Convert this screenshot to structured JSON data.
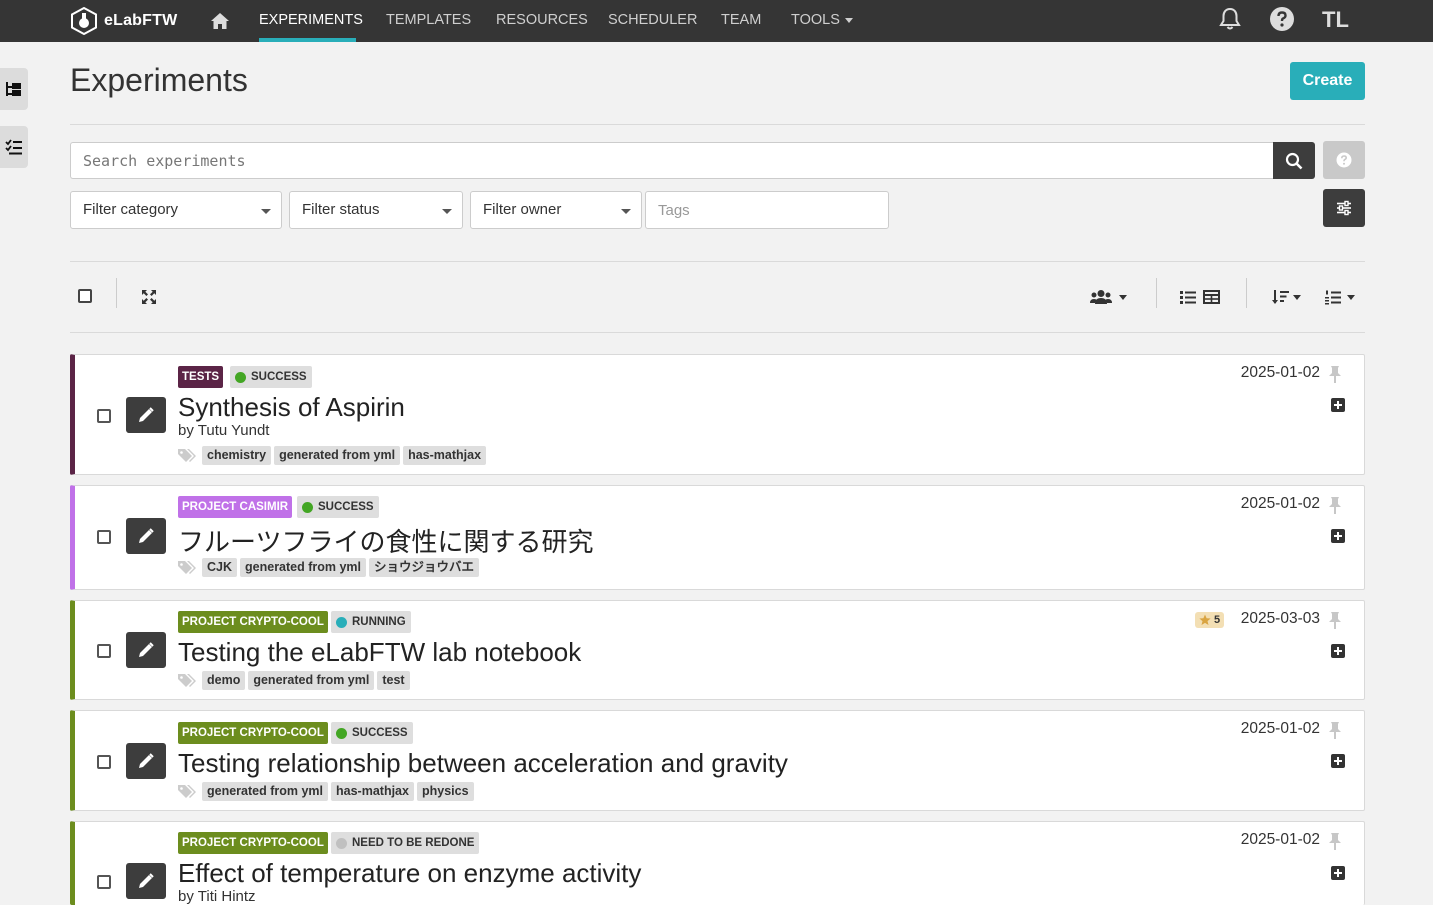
{
  "brand": {
    "name": "eLabFTW"
  },
  "nav": {
    "items": [
      {
        "label": "EXPERIMENTS",
        "active": true
      },
      {
        "label": "TEMPLATES"
      },
      {
        "label": "RESOURCES"
      },
      {
        "label": "SCHEDULER"
      },
      {
        "label": "TEAM"
      },
      {
        "label": "TOOLS",
        "dropdown": true
      }
    ],
    "icons": [
      "home-icon",
      "bell-icon",
      "help-icon"
    ],
    "user_initials": "TL"
  },
  "page": {
    "title": "Experiments",
    "create_label": "Create"
  },
  "search": {
    "placeholder": "Search experiments",
    "filters": {
      "category": "Filter category",
      "status": "Filter status",
      "owner": "Filter owner",
      "tags_placeholder": "Tags"
    }
  },
  "colors": {
    "accent": "#29aeb9",
    "topbar": "#353535",
    "dark_button": "#3d3d3d"
  },
  "entities": [
    {
      "category": "TESTS",
      "category_color": "#5b2446",
      "status": "SUCCESS",
      "status_color": "#43a624",
      "title": "Synthesis of Aspirin",
      "owner_prefix": "by",
      "owner": "Tutu Yundt",
      "tags": [
        "chemistry",
        "generated from yml",
        "has-mathjax"
      ],
      "date": "2025-01-02"
    },
    {
      "category": "PROJECT CASIMIR",
      "category_color": "#c071e8",
      "status": "SUCCESS",
      "status_color": "#43a624",
      "title": "フルーツフライの食性に関する研究",
      "owner_prefix": "",
      "owner": "",
      "tags": [
        "CJK",
        "generated from yml",
        "ショウジョウバエ"
      ],
      "date": "2025-01-02"
    },
    {
      "category": "PROJECT CRYPTO-COOL",
      "category_color": "#6c8d1e",
      "status": "RUNNING",
      "status_color": "#29aeb9",
      "title": "Testing the eLabFTW lab notebook",
      "owner_prefix": "",
      "owner": "",
      "tags": [
        "demo",
        "generated from yml",
        "test"
      ],
      "date": "2025-03-03",
      "rating": "5"
    },
    {
      "category": "PROJECT CRYPTO-COOL",
      "category_color": "#6c8d1e",
      "status": "SUCCESS",
      "status_color": "#43a624",
      "title": "Testing relationship between acceleration and gravity",
      "owner_prefix": "",
      "owner": "",
      "tags": [
        "generated from yml",
        "has-mathjax",
        "physics"
      ],
      "date": "2025-01-02"
    },
    {
      "category": "PROJECT CRYPTO-COOL",
      "category_color": "#6c8d1e",
      "status": "NEED TO BE REDONE",
      "status_color": "#c0c0c0",
      "title": "Effect of temperature on enzyme activity",
      "owner_prefix": "by",
      "owner": "Titi Hintz",
      "tags": [],
      "date": "2025-01-02"
    }
  ]
}
